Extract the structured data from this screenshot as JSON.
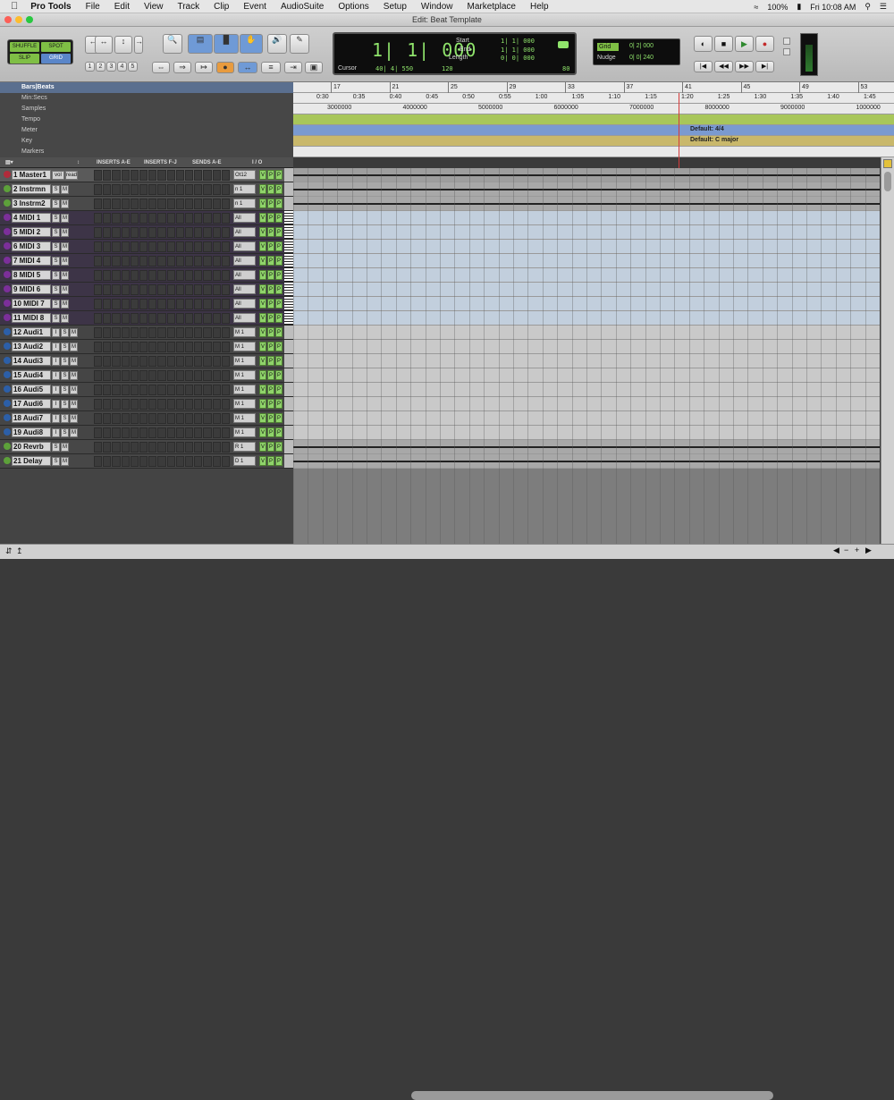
{
  "menubar": {
    "apple": "",
    "app": "Pro Tools",
    "items": [
      "File",
      "Edit",
      "View",
      "Track",
      "Clip",
      "Event",
      "AudioSuite",
      "Options",
      "Setup",
      "Window",
      "Marketplace",
      "Help"
    ],
    "battery": "100%",
    "clock": "Fri 10:08 AM"
  },
  "window": {
    "title": "Edit: Beat Template"
  },
  "toolbar": {
    "modes": [
      "SHUFFLE",
      "SPOT",
      "SLIP",
      "GRID"
    ],
    "selected_mode": "GRID",
    "zoom_presets": [
      "1",
      "2",
      "3",
      "4",
      "5"
    ],
    "counter": {
      "main": "1| 1| 000",
      "labels": {
        "start": "Start",
        "end": "End",
        "length": "Length",
        "cursor": "Cursor"
      },
      "start": "1| 1| 000",
      "end": "1| 1| 000",
      "length": "0| 0| 000",
      "cursor": "40| 4| 550",
      "tempo": "120",
      "extra": "80"
    },
    "grid": {
      "label": "Grid",
      "value": "0| 2| 000"
    },
    "nudge": {
      "label": "Nudge",
      "value": "0| 0| 240"
    }
  },
  "rulers": {
    "rows": [
      "Bars|Beats",
      "Min:Secs",
      "Samples",
      "Tempo",
      "Meter",
      "Key",
      "Markers"
    ],
    "bars": [
      "17",
      "21",
      "25",
      "29",
      "33",
      "37",
      "41",
      "45",
      "49",
      "53"
    ],
    "minsecs": [
      "0:30",
      "0:35",
      "0:40",
      "0:45",
      "0:50",
      "0:55",
      "1:00",
      "1:05",
      "1:10",
      "1:15",
      "1:20",
      "1:25",
      "1:30",
      "1:35",
      "1:40",
      "1:45"
    ],
    "samples": [
      "3000000",
      "4000000",
      "5000000",
      "6000000",
      "7000000",
      "8000000",
      "9000000",
      "1000000"
    ],
    "meter_label": "Default: 4/4",
    "key_label": "Default: C major"
  },
  "track_header": {
    "inserts_ae": "INSERTS A-E",
    "inserts_fj": "INSERTS F-J",
    "sends_ae": "SENDS A-E",
    "io": "I / O"
  },
  "tracks": [
    {
      "name": "1 Master1",
      "io": "Ot12",
      "kind": "master",
      "color": "#b12b3b",
      "btns": [
        "vol",
        "read"
      ]
    },
    {
      "name": "2 Instrmn",
      "io": "n 1",
      "kind": "inst",
      "color": "#5da13a",
      "btns": [
        "S",
        "M"
      ]
    },
    {
      "name": "3 Instrm2",
      "io": "n 1",
      "kind": "inst",
      "color": "#5da13a",
      "btns": [
        "S",
        "M"
      ]
    },
    {
      "name": "4  MIDI 1",
      "io": "All",
      "kind": "midi",
      "color": "#7c2f9a",
      "btns": [
        "S",
        "M"
      ]
    },
    {
      "name": "5  MIDI 2",
      "io": "All",
      "kind": "midi",
      "color": "#7c2f9a",
      "btns": [
        "S",
        "M"
      ]
    },
    {
      "name": "6  MIDI 3",
      "io": "All",
      "kind": "midi",
      "color": "#7c2f9a",
      "btns": [
        "S",
        "M"
      ]
    },
    {
      "name": "7  MIDI 4",
      "io": "All",
      "kind": "midi",
      "color": "#7c2f9a",
      "btns": [
        "S",
        "M"
      ]
    },
    {
      "name": "8  MIDI 5",
      "io": "All",
      "kind": "midi",
      "color": "#7c2f9a",
      "btns": [
        "S",
        "M"
      ]
    },
    {
      "name": "9  MIDI 6",
      "io": "All",
      "kind": "midi",
      "color": "#7c2f9a",
      "btns": [
        "S",
        "M"
      ]
    },
    {
      "name": "10 MIDI 7",
      "io": "All",
      "kind": "midi",
      "color": "#7c2f9a",
      "btns": [
        "S",
        "M"
      ]
    },
    {
      "name": "11 MIDI 8",
      "io": "All",
      "kind": "midi",
      "color": "#7c2f9a",
      "btns": [
        "S",
        "M"
      ]
    },
    {
      "name": "12 Audi1",
      "io": "M 1",
      "kind": "audio",
      "color": "#2c5fa8",
      "btns": [
        "I",
        "S",
        "M"
      ]
    },
    {
      "name": "13 Audi2",
      "io": "M 1",
      "kind": "audio",
      "color": "#2c5fa8",
      "btns": [
        "I",
        "S",
        "M"
      ]
    },
    {
      "name": "14 Audi3",
      "io": "M 1",
      "kind": "audio",
      "color": "#2c5fa8",
      "btns": [
        "I",
        "S",
        "M"
      ]
    },
    {
      "name": "15 Audi4",
      "io": "M 1",
      "kind": "audio",
      "color": "#2c5fa8",
      "btns": [
        "I",
        "S",
        "M"
      ]
    },
    {
      "name": "16 Audi5",
      "io": "M 1",
      "kind": "audio",
      "color": "#2c5fa8",
      "btns": [
        "I",
        "S",
        "M"
      ]
    },
    {
      "name": "17 Audi6",
      "io": "M 1",
      "kind": "audio",
      "color": "#2c5fa8",
      "btns": [
        "I",
        "S",
        "M"
      ]
    },
    {
      "name": "18 Audi7",
      "io": "M 1",
      "kind": "audio",
      "color": "#2c5fa8",
      "btns": [
        "I",
        "S",
        "M"
      ]
    },
    {
      "name": "19 Audi8",
      "io": "M 1",
      "kind": "audio",
      "color": "#2c5fa8",
      "btns": [
        "I",
        "S",
        "M"
      ]
    },
    {
      "name": "20 Revrb",
      "io": "R 1",
      "kind": "aux",
      "color": "#5da13a",
      "btns": [
        "S",
        "M"
      ]
    },
    {
      "name": "21  Delay",
      "io": "D 1",
      "kind": "aux",
      "color": "#5da13a",
      "btns": [
        "S",
        "M"
      ]
    }
  ],
  "vp_labels": [
    "V",
    "P",
    "P"
  ]
}
